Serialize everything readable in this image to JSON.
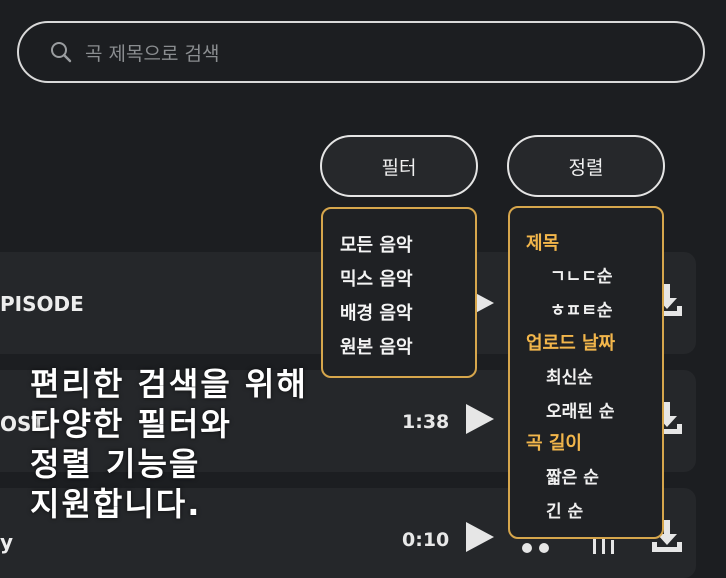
{
  "search": {
    "placeholder": "곡 제목으로 검색"
  },
  "buttons": {
    "filter": "필터",
    "sort": "정렬"
  },
  "songs": [
    {
      "title": "PISODE",
      "duration": ""
    },
    {
      "title": "OST",
      "duration": "1:38"
    },
    {
      "title": "y",
      "duration": "0:10"
    }
  ],
  "filter_menu": {
    "options": [
      "모든 음악",
      "믹스 음악",
      "배경 음악",
      "원본 음악"
    ]
  },
  "sort_menu": {
    "groups": [
      {
        "header": "제목",
        "options": [
          "ㄱㄴㄷ순",
          "ㅎㅍㅌ순"
        ]
      },
      {
        "header": "업로드 날짜",
        "options": [
          "최신순",
          "오래된 순"
        ]
      },
      {
        "header": "곡 길이",
        "options": [
          "짧은 순",
          "긴 순"
        ]
      }
    ]
  },
  "promo_text": [
    "편리한 검색을 위해",
    "다양한 필터와",
    "정렬 기능을",
    "지원합니다."
  ],
  "colors": {
    "accent": "#f2b64b",
    "background": "#1c1e21",
    "row": "#25272a"
  }
}
